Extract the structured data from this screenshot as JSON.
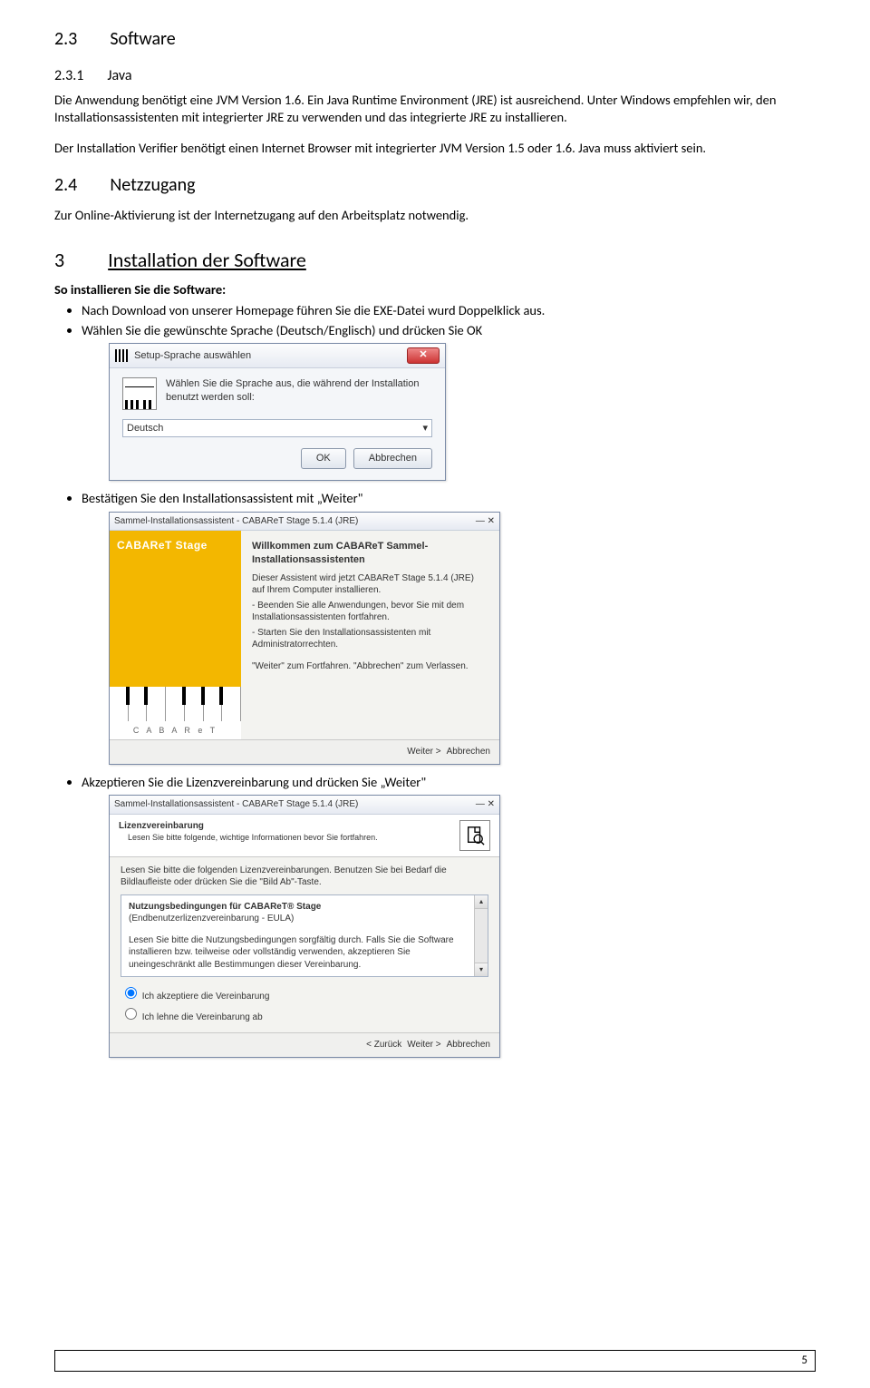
{
  "sec23": {
    "num": "2.3",
    "title": "Software"
  },
  "sec231": {
    "num": "2.3.1",
    "title": "Java"
  },
  "p231a": "Die Anwendung benötigt eine JVM Version 1.6. Ein Java Runtime Environment (JRE) ist ausreichend. Unter Windows empfehlen wir, den Installationsassistenten mit integrierter JRE zu verwenden und das integrierte JRE zu installieren.",
  "p231b": "Der Installation Verifier benötigt einen Internet Browser mit integrierter JVM Version 1.5 oder 1.6. Java muss aktiviert sein.",
  "sec24": {
    "num": "2.4",
    "title": "Netzzugang"
  },
  "p24": "Zur Online-Aktivierung ist der Internetzugang auf den Arbeitsplatz notwendig.",
  "sec3": {
    "num": "3",
    "title": "Installation der Software"
  },
  "install_intro": "So installieren Sie die Software:",
  "bullets": {
    "b1": "Nach Download von unserer Homepage führen Sie die EXE-Datei wurd Doppelklick aus.",
    "b2": "Wählen Sie die gewünschte Sprache (Deutsch/Englisch) und drücken Sie OK",
    "b3": "Bestätigen Sie den Installationsassistent mit „Weiter\"",
    "b4": "Akzeptieren Sie die Lizenzvereinbarung und drücken Sie „Weiter\""
  },
  "dlg1": {
    "title": "Setup-Sprache auswählen",
    "text": "Wählen Sie die Sprache aus, die während der Installation benutzt werden soll:",
    "lang": "Deutsch",
    "ok": "OK",
    "cancel": "Abbrechen"
  },
  "dlg2": {
    "title": "Sammel-Installationsassistent - CABAReT Stage 5.1.4 (JRE)",
    "product": "CABAReT Stage",
    "heading": "Willkommen zum CABAReT Sammel-Installationsassistenten",
    "p1": "Dieser Assistent wird jetzt CABAReT Stage 5.1.4 (JRE) auf Ihrem Computer installieren.",
    "p2a": "- Beenden Sie alle Anwendungen, bevor Sie mit dem Installationsassistenten fortfahren.",
    "p2b": "- Starten Sie den Installationsassistenten mit Administratorrechten.",
    "p3": "\"Weiter\" zum Fortfahren. \"Abbrechen\" zum Verlassen.",
    "letters": "C A B A R e T",
    "next": "Weiter >",
    "cancel": "Abbrechen"
  },
  "dlg3": {
    "title": "Sammel-Installationsassistent - CABAReT Stage 5.1.4 (JRE)",
    "h": "Lizenzvereinbarung",
    "hs": "Lesen Sie bitte folgende, wichtige Informationen bevor Sie fortfahren.",
    "instr": "Lesen Sie bitte die folgenden Lizenzvereinbarungen. Benutzen Sie bei Bedarf die Bildlaufleiste oder drücken Sie die \"Bild Ab\"-Taste.",
    "eula_t1": "Nutzungsbedingungen für CABAReT® Stage",
    "eula_t2": "(Endbenutzerlizenzvereinbarung - EULA)",
    "eula_p": "Lesen Sie bitte die Nutzungsbedingungen sorgfältig durch. Falls Sie die Software installieren bzw. teilweise oder vollständig verwenden, akzeptieren Sie uneingeschränkt alle Bestimmungen dieser Vereinbarung.",
    "r_accept": "Ich akzeptiere die Vereinbarung",
    "r_decline": "Ich lehne die Vereinbarung ab",
    "back": "< Zurück",
    "next": "Weiter >",
    "cancel": "Abbrechen"
  },
  "pagenum": "5"
}
